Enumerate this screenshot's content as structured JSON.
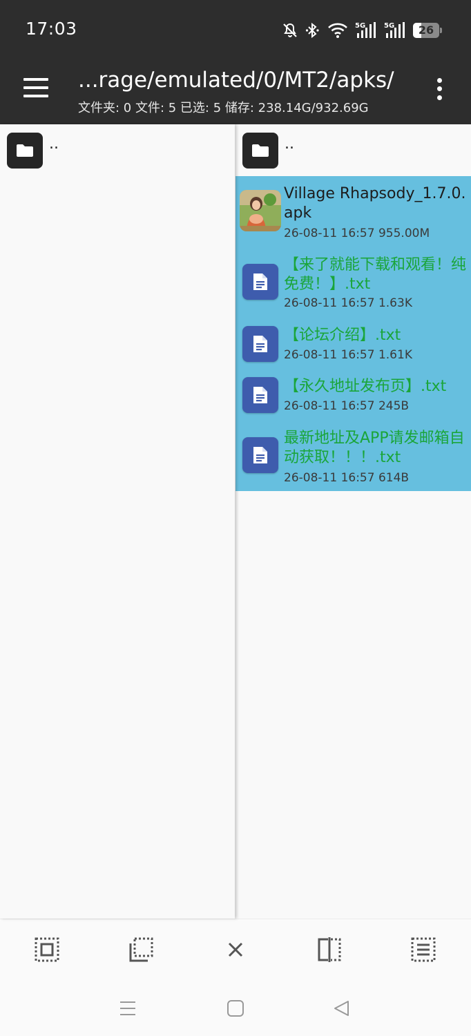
{
  "status": {
    "time": "17:03",
    "battery": "26",
    "net1": "5G",
    "net2": "5G"
  },
  "toolbar": {
    "path": "...rage/emulated/0/MT2/apks/",
    "info": "文件夹: 0  文件: 5  已选: 5  储存: 238.14G/932.69G"
  },
  "left_pane": {
    "up_label": ".."
  },
  "right_pane": {
    "up_label": "..",
    "files": [
      {
        "name": "Village Rhapsody_1.7.0.apk",
        "meta": "26-08-11 16:57  955.00M",
        "icon": "app-icon"
      },
      {
        "name": "【来了就能下载和观看！纯免费！】.txt",
        "meta": "26-08-11 16:57  1.63K",
        "icon": "document-icon"
      },
      {
        "name": "【论坛介绍】.txt",
        "meta": "26-08-11 16:57  1.61K",
        "icon": "document-icon"
      },
      {
        "name": "【永久地址发布页】.txt",
        "meta": "26-08-11 16:57  245B",
        "icon": "document-icon"
      },
      {
        "name": "最新地址及APP请发邮箱自动获取！！！.txt",
        "meta": "26-08-11 16:57  614B",
        "icon": "document-icon"
      }
    ]
  },
  "colors": {
    "bar": "#2d2d2d",
    "selection": "#66bfdf",
    "doc_tile": "#3e5cad",
    "green_text": "#1aa53a"
  }
}
